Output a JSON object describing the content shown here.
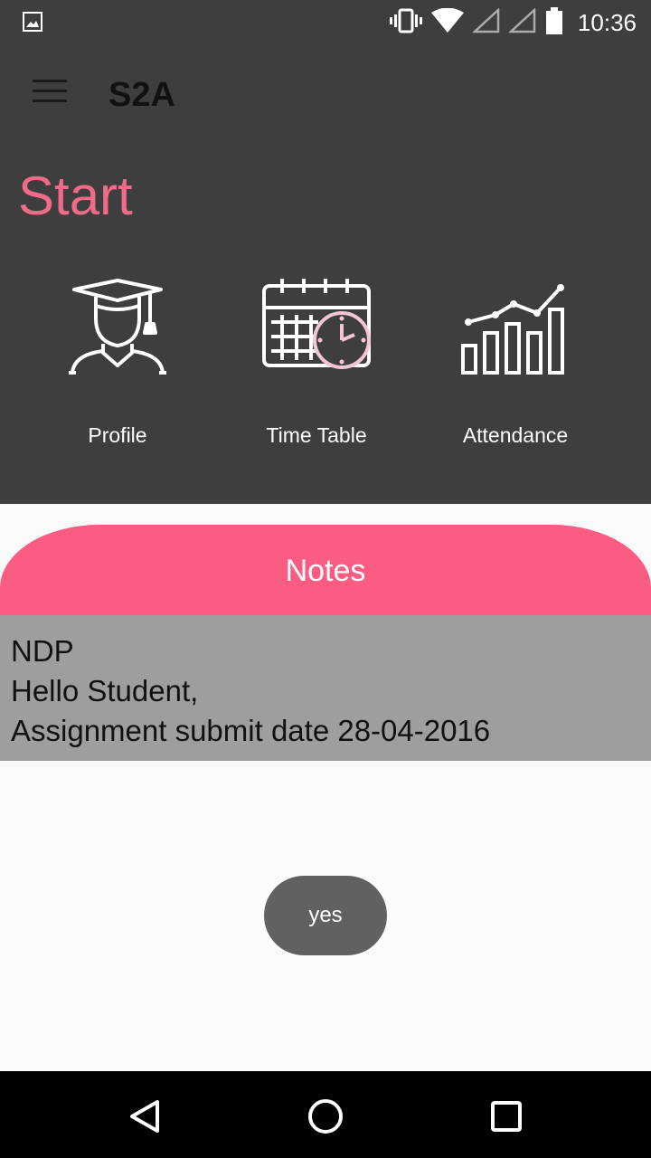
{
  "status_bar": {
    "left_icon": "image-icon",
    "icons": [
      "vibrate-icon",
      "wifi-icon",
      "signal-icon",
      "signal-icon",
      "battery-icon"
    ],
    "time": "10:36"
  },
  "app_bar": {
    "menu_icon": "menu-icon",
    "title": "S2A"
  },
  "start": {
    "title": "Start",
    "tiles": [
      {
        "label": "Profile",
        "icon": "graduate-icon"
      },
      {
        "label": "Time Table",
        "icon": "calendar-clock-icon"
      },
      {
        "label": "Attendance",
        "icon": "bar-chart-icon"
      }
    ]
  },
  "notes": {
    "header": "Notes",
    "items": [
      {
        "lines": [
          "NDP",
          "Hello Student,",
          "Assignment submit date 28-04-2016"
        ]
      }
    ]
  },
  "toast": {
    "text": "yes"
  },
  "nav_bar": {
    "buttons": [
      "back-icon",
      "home-icon",
      "recents-icon"
    ]
  },
  "colors": {
    "dark_bg": "#3f3e3e",
    "accent_pink": "#fb5c81",
    "start_title": "#f06a8a",
    "note_bg": "#9e9e9e",
    "toast_bg": "#616161"
  }
}
